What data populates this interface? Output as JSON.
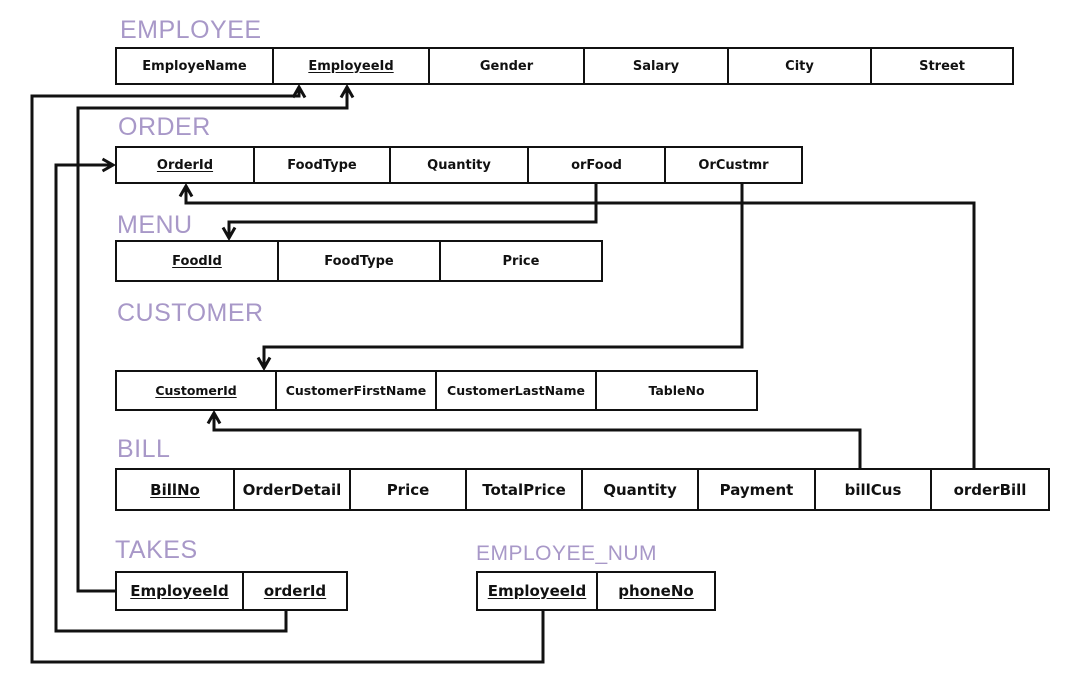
{
  "diagram": {
    "type": "relational-schema",
    "tables": [
      {
        "name": "EMPLOYEE",
        "columns": [
          {
            "label": "EmployeName",
            "pk": false
          },
          {
            "label": "EmployeeId",
            "pk": true
          },
          {
            "label": "Gender",
            "pk": false
          },
          {
            "label": "Salary",
            "pk": false
          },
          {
            "label": "City",
            "pk": false
          },
          {
            "label": "Street",
            "pk": false
          }
        ]
      },
      {
        "name": "ORDER",
        "columns": [
          {
            "label": "OrderId",
            "pk": true
          },
          {
            "label": "FoodType",
            "pk": false
          },
          {
            "label": "Quantity",
            "pk": false
          },
          {
            "label": "orFood",
            "pk": false
          },
          {
            "label": "OrCustmr",
            "pk": false
          }
        ]
      },
      {
        "name": "MENU",
        "columns": [
          {
            "label": "FoodId",
            "pk": true
          },
          {
            "label": "FoodType",
            "pk": false
          },
          {
            "label": "Price",
            "pk": false
          }
        ]
      },
      {
        "name": "CUSTOMER",
        "columns": [
          {
            "label": "CustomerId",
            "pk": true
          },
          {
            "label": "CustomerFirstName",
            "pk": false
          },
          {
            "label": "CustomerLastName",
            "pk": false
          },
          {
            "label": "TableNo",
            "pk": false
          }
        ]
      },
      {
        "name": "BILL",
        "columns": [
          {
            "label": "BillNo",
            "pk": true
          },
          {
            "label": "OrderDetail",
            "pk": false
          },
          {
            "label": "Price",
            "pk": false
          },
          {
            "label": "TotalPrice",
            "pk": false
          },
          {
            "label": "Quantity",
            "pk": false
          },
          {
            "label": "Payment",
            "pk": false
          },
          {
            "label": "billCus",
            "pk": false
          },
          {
            "label": "orderBill",
            "pk": false
          }
        ]
      },
      {
        "name": "TAKES",
        "columns": [
          {
            "label": "EmployeeId",
            "pk": true
          },
          {
            "label": "orderId",
            "pk": true
          }
        ]
      },
      {
        "name": "EMPLOYEE_NUM",
        "columns": [
          {
            "label": "EmployeeId",
            "pk": true
          },
          {
            "label": "phoneNo",
            "pk": true
          }
        ]
      }
    ],
    "relationships": [
      {
        "from": "ORDER.orFood",
        "to": "MENU.FoodId"
      },
      {
        "from": "ORDER.OrCustmr",
        "to": "CUSTOMER.CustomerId"
      },
      {
        "from": "BILL.billCus",
        "to": "CUSTOMER.CustomerId"
      },
      {
        "from": "BILL.orderBill",
        "to": "ORDER.OrderId"
      },
      {
        "from": "TAKES.EmployeeId",
        "to": "EMPLOYEE.EmployeeId"
      },
      {
        "from": "TAKES.orderId",
        "to": "ORDER.OrderId"
      },
      {
        "from": "EMPLOYEE_NUM.EmployeeId",
        "to": "EMPLOYEE.EmployeeId"
      }
    ],
    "colors": {
      "title": "#a898c8",
      "line": "#111111"
    }
  }
}
